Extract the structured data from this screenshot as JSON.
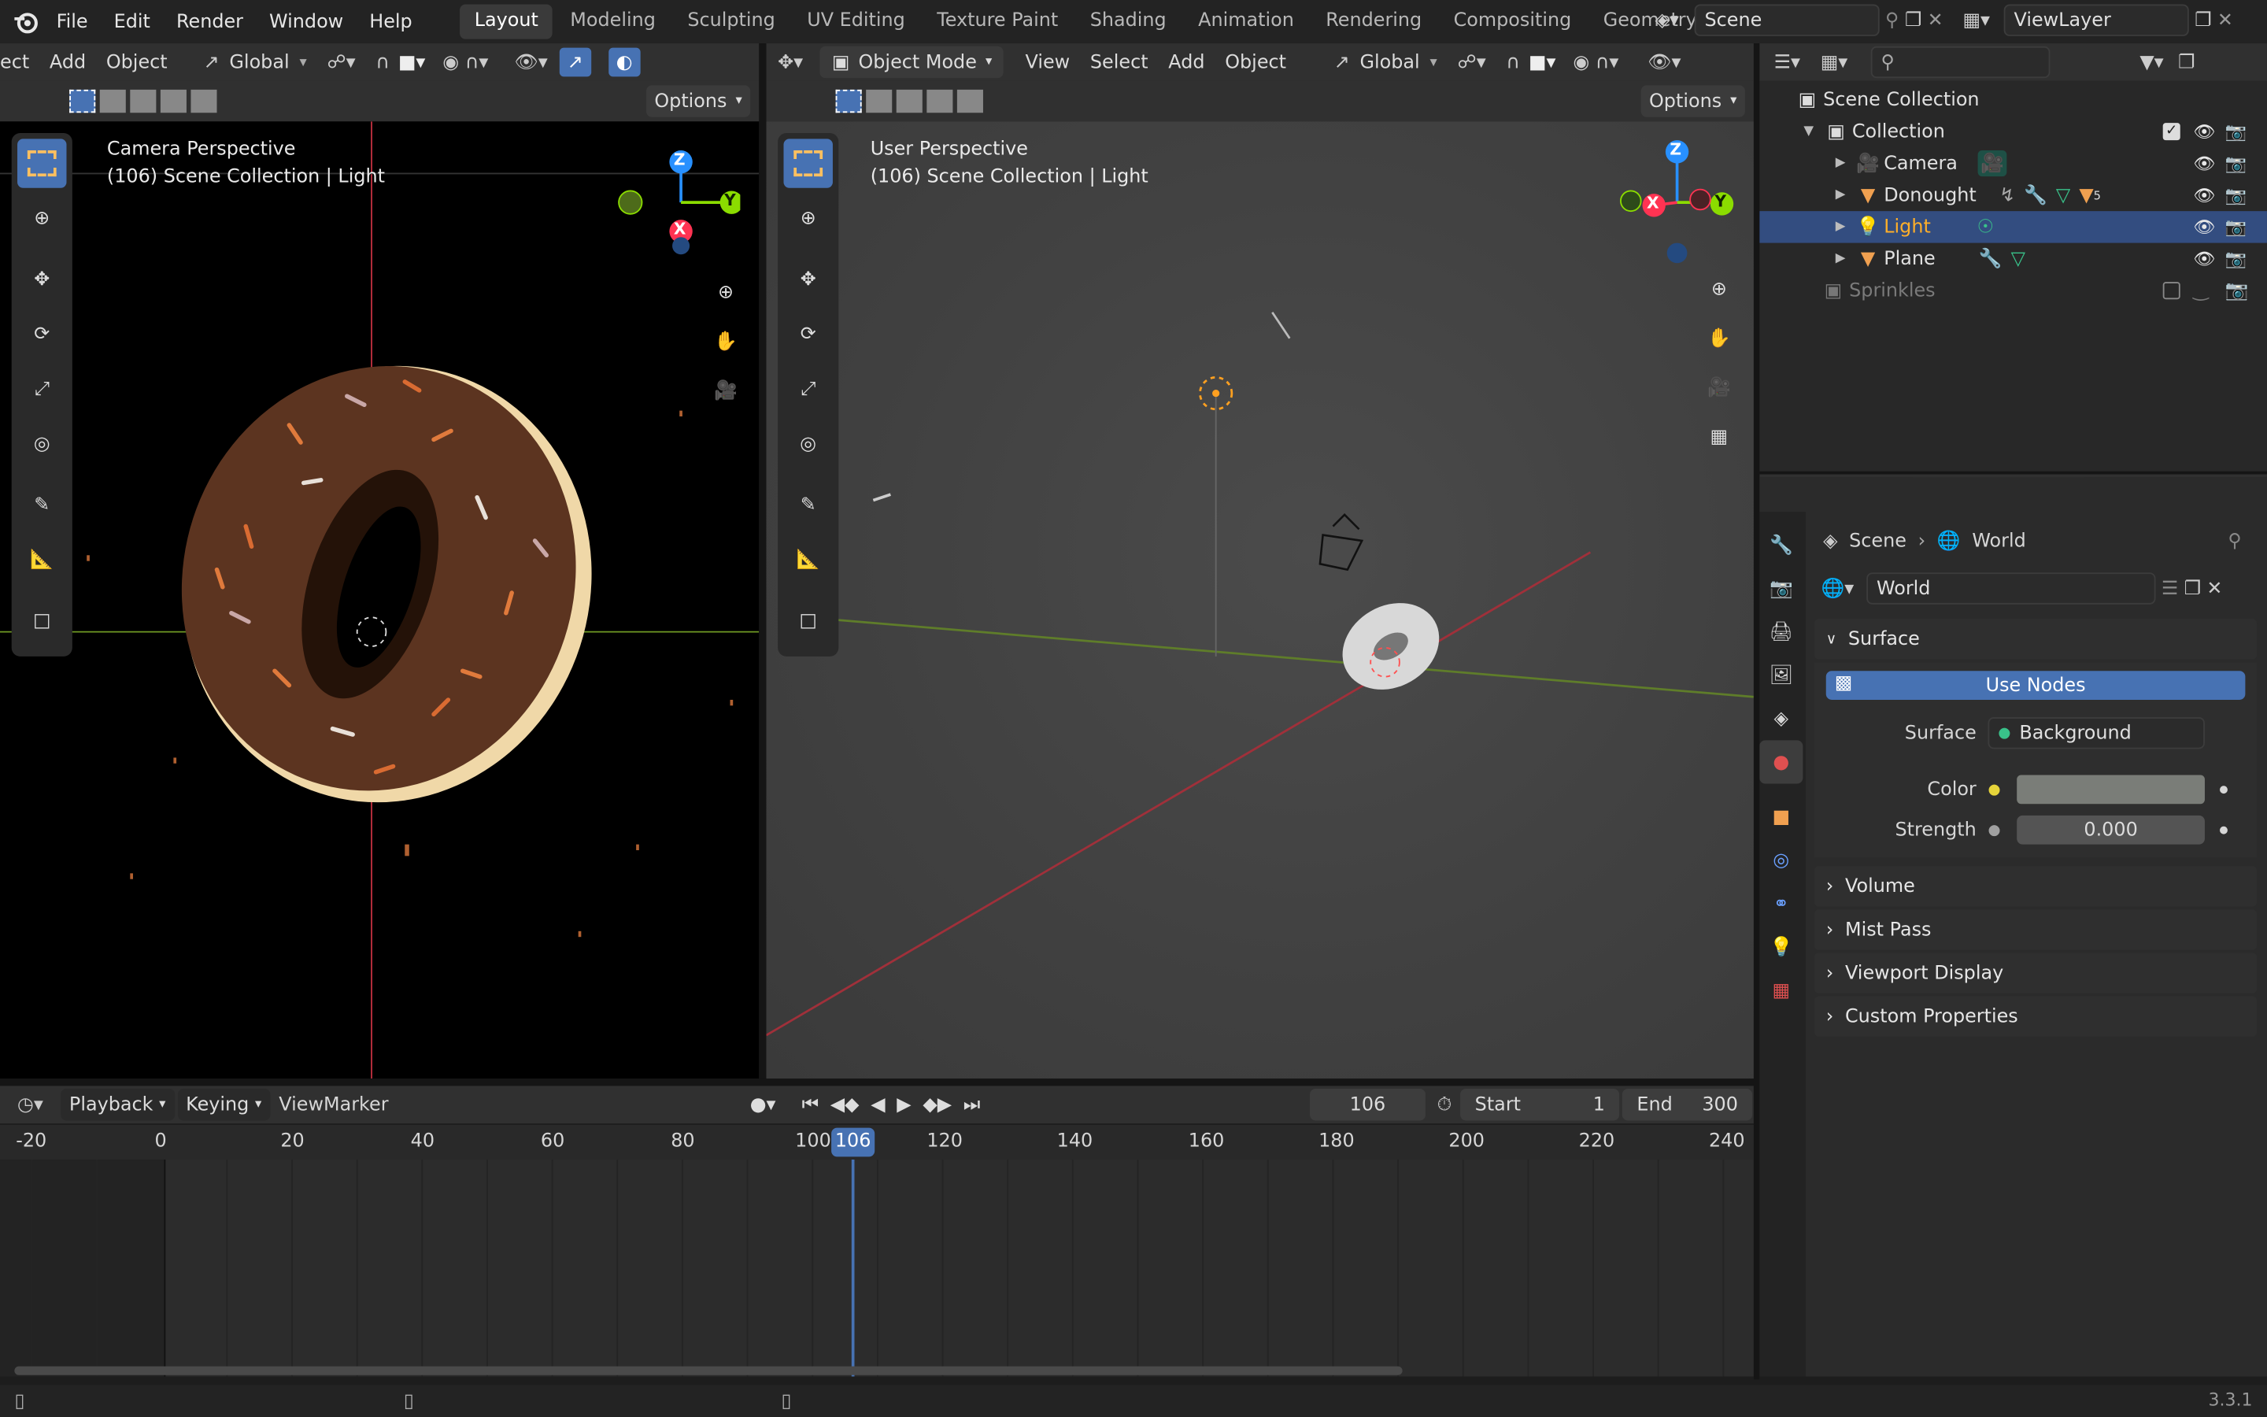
{
  "menu": [
    "File",
    "Edit",
    "Render",
    "Window",
    "Help"
  ],
  "workspaces": [
    "Layout",
    "Modeling",
    "Sculpting",
    "UV Editing",
    "Texture Paint",
    "Shading",
    "Animation",
    "Rendering",
    "Compositing",
    "Geometry Nodes"
  ],
  "active_workspace": "Layout",
  "scene_name": "Scene",
  "view_layer": "ViewLayer",
  "left_vp": {
    "header": {
      "menu_cut": "ect",
      "add": "Add",
      "object": "Object",
      "transform": "Global",
      "options": "Options"
    },
    "overlay_line1": "Camera Perspective",
    "overlay_line2": "(106) Scene Collection | Light",
    "axis": {
      "z": "Z",
      "y": "Y",
      "x": "X"
    }
  },
  "right_vp": {
    "header": {
      "mode": "Object Mode",
      "view": "View",
      "select": "Select",
      "add": "Add",
      "object": "Object",
      "transform": "Global",
      "options": "Options"
    },
    "overlay_line1": "User Perspective",
    "overlay_line2": "(106) Scene Collection | Light",
    "axis": {
      "z": "Z",
      "y": "Y",
      "x": "X"
    }
  },
  "outliner": {
    "root": "Scene Collection",
    "collection": "Collection",
    "items": [
      {
        "name": "Camera",
        "selected": false
      },
      {
        "name": "Donought",
        "selected": false,
        "badge": "5"
      },
      {
        "name": "Light",
        "selected": true
      },
      {
        "name": "Plane",
        "selected": false
      }
    ],
    "excluded": "Sprinkles"
  },
  "properties": {
    "breadcrumb_scene": "Scene",
    "breadcrumb_world": "World",
    "world_name": "World",
    "surface_panel": "Surface",
    "use_nodes": "Use Nodes",
    "surface_label": "Surface",
    "surface_value": "Background",
    "color_label": "Color",
    "strength_label": "Strength",
    "strength_value": "0.000",
    "panels": [
      "Volume",
      "Mist Pass",
      "Viewport Display",
      "Custom Properties"
    ]
  },
  "timeline": {
    "playback": "Playback",
    "keying": "Keying",
    "view": "View",
    "marker": "Marker",
    "current_frame": "106",
    "start_label": "Start",
    "start": "1",
    "end_label": "End",
    "end": "300",
    "ticks": [
      "-20",
      "0",
      "20",
      "40",
      "60",
      "80",
      "100",
      "120",
      "140",
      "160",
      "180",
      "200",
      "220",
      "240"
    ]
  },
  "version": "3.3.1",
  "colors": {
    "accent": "#4772b3",
    "selected_text": "#ffaf29",
    "axis_x": "#ff3352",
    "axis_y": "#8bdc00",
    "axis_z": "#2890ff"
  }
}
